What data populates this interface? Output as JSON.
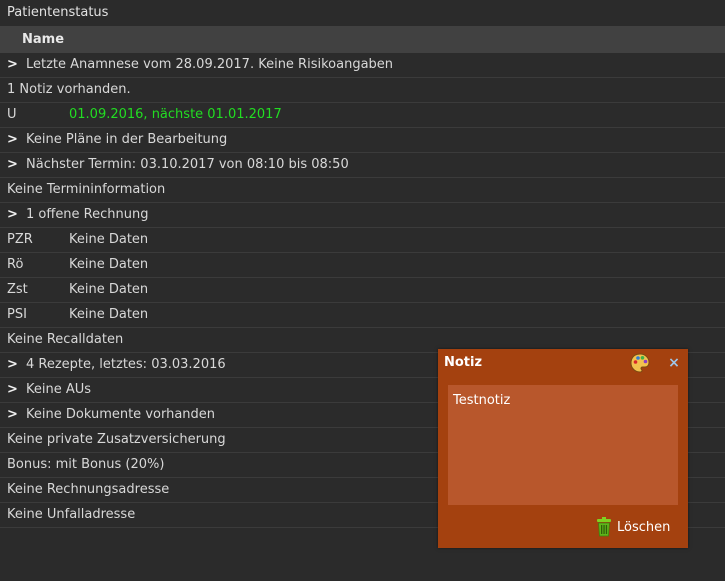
{
  "window": {
    "title": "Patientenstatus"
  },
  "table": {
    "column_header": "Name"
  },
  "rows": [
    {
      "text": "Letzte Anamnese vom 28.09.2017. Keine Risikoangaben"
    },
    {
      "text": "1 Notiz vorhanden."
    },
    {
      "label": "U",
      "value": "01.09.2016, nächste 01.01.2017"
    },
    {
      "text": "Keine Pläne in der Bearbeitung"
    },
    {
      "text": "Nächster Termin: 03.10.2017 von 08:10 bis 08:50"
    },
    {
      "text": "Keine Termininformation"
    },
    {
      "text": "1 offene Rechnung"
    },
    {
      "label": "PZR",
      "value": "Keine Daten"
    },
    {
      "label": "Rö",
      "value": "Keine Daten"
    },
    {
      "label": "Zst",
      "value": "Keine Daten"
    },
    {
      "label": "PSI",
      "value": "Keine Daten"
    },
    {
      "text": "Keine Recalldaten"
    },
    {
      "text": "4 Rezepte, letztes: 03.03.2016"
    },
    {
      "text": "Keine AUs"
    },
    {
      "text": "Keine Dokumente vorhanden"
    },
    {
      "text": "Keine private Zusatzversicherung"
    },
    {
      "text": "Bonus: mit Bonus (20%)"
    },
    {
      "text": "Keine Rechnungsadresse"
    },
    {
      "text": "Keine Unfalladresse"
    }
  ],
  "note": {
    "title": "Notiz",
    "content": "Testnotiz",
    "delete_label": "Löschen",
    "close_symbol": "×"
  },
  "icons": {
    "expand": "chevron-right-icon",
    "palette": "palette-icon",
    "close": "close-icon",
    "trash": "trash-icon"
  },
  "colors": {
    "background": "#2b2b2b",
    "header": "#414141",
    "highlight_green": "#22dd22",
    "note_background": "#a4410f",
    "note_content": "#b8572c"
  }
}
